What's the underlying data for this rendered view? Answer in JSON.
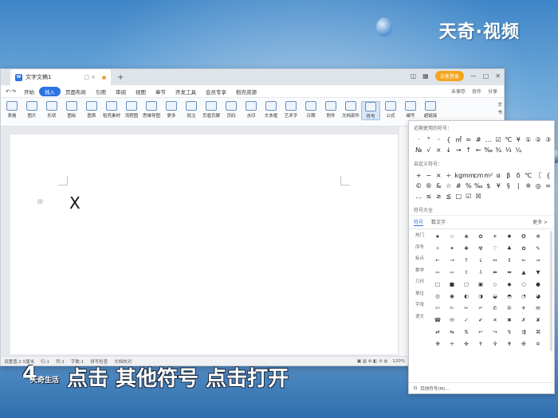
{
  "watermark": "天奇·视频",
  "window": {
    "doc_tab": "文字文稿1",
    "new_tab": "+",
    "login": "访客登录",
    "menu": [
      "开始",
      "插入",
      "页面布局",
      "引用",
      "审阅",
      "视图",
      "章节",
      "开发工具",
      "会员专享",
      "稻壳资源"
    ],
    "active_menu": "插入",
    "menu_right": [
      "未保存",
      "协作",
      "分享"
    ],
    "ribbon": [
      "表格",
      "图片",
      "形状",
      "图标",
      "图表",
      "稻壳素材",
      "流程图",
      "思维导图",
      "更多",
      "批注",
      "页眉页脚",
      "页码",
      "水印",
      "文本框",
      "艺术字",
      "日期",
      "附件",
      "文档部件",
      "符号",
      "公式",
      "编号",
      "超链接",
      "书签"
    ],
    "ribbon_right": [
      "文",
      "书"
    ],
    "doc_text": "X",
    "status": [
      "页面:1",
      "节:1/1",
      "设置值:2.5厘米",
      "行:1",
      "列:1",
      "字数:1",
      "拼写检查",
      "文档校对"
    ],
    "zoom": "120%"
  },
  "symbol_panel": {
    "recent_title": "近期使用的符号：",
    "recent": [
      "·",
      "°",
      "◦",
      "{",
      "㎡",
      "≈",
      "#",
      "…",
      "☑",
      "℃",
      "¥",
      "①",
      "②",
      "③",
      "№",
      "√",
      "×",
      "↓",
      "→",
      "↑",
      "←",
      "‰",
      "¾",
      "⅓",
      "¼"
    ],
    "custom_title": "自定义符号：",
    "custom": [
      "+",
      "−",
      "×",
      "÷",
      "kg",
      "mm",
      "cm",
      "m²",
      "α",
      "β",
      "δ",
      "℃",
      "〖",
      "{",
      "©",
      "®",
      "&",
      "☆",
      "#",
      "%",
      "‰",
      "$",
      "¥",
      "§",
      "|",
      "※",
      "◎",
      "≈",
      "…",
      "≤",
      "≥",
      "≦",
      "□",
      "☑",
      "☒"
    ],
    "all_title": "符号大全",
    "tabs": [
      "符号",
      "数文字"
    ],
    "more": "更多 >",
    "categories": [
      "热门",
      "序号",
      "标点",
      "数学",
      "几何",
      "单位",
      "字母",
      "语文"
    ],
    "grid": [
      "★",
      "☆",
      "❀",
      "✿",
      "☀",
      "✹",
      "✪",
      "❄",
      "✧",
      "✦",
      "✚",
      "☢",
      "♡",
      "♣",
      "✿",
      "✎",
      "←",
      "→",
      "↑",
      "↓",
      "↔",
      "↕",
      "⇐",
      "⇒",
      "⇦",
      "⇨",
      "⇧",
      "⇩",
      "⬅",
      "➡",
      "▲",
      "▼",
      "□",
      "■",
      "▢",
      "▣",
      "◇",
      "◆",
      "○",
      "●",
      "◎",
      "◉",
      "◐",
      "◑",
      "◒",
      "◓",
      "◔",
      "◕",
      "✄",
      "✁",
      "✂",
      "✃",
      "✆",
      "✇",
      "✈",
      "✉",
      "☎",
      "☏",
      "✓",
      "✔",
      "✕",
      "✖",
      "✗",
      "✘",
      "⇄",
      "⇆",
      "⇅",
      "↩",
      "↪",
      "↯",
      "⇶",
      "⌘",
      "✙",
      "✛",
      "✜",
      "✝",
      "✞",
      "✟",
      "✠",
      "✡"
    ],
    "footer": "其他符号(M)..."
  },
  "subtitle": {
    "step": "4",
    "text": "点击 其他符号 点击打开",
    "logo": "天奇生活"
  }
}
